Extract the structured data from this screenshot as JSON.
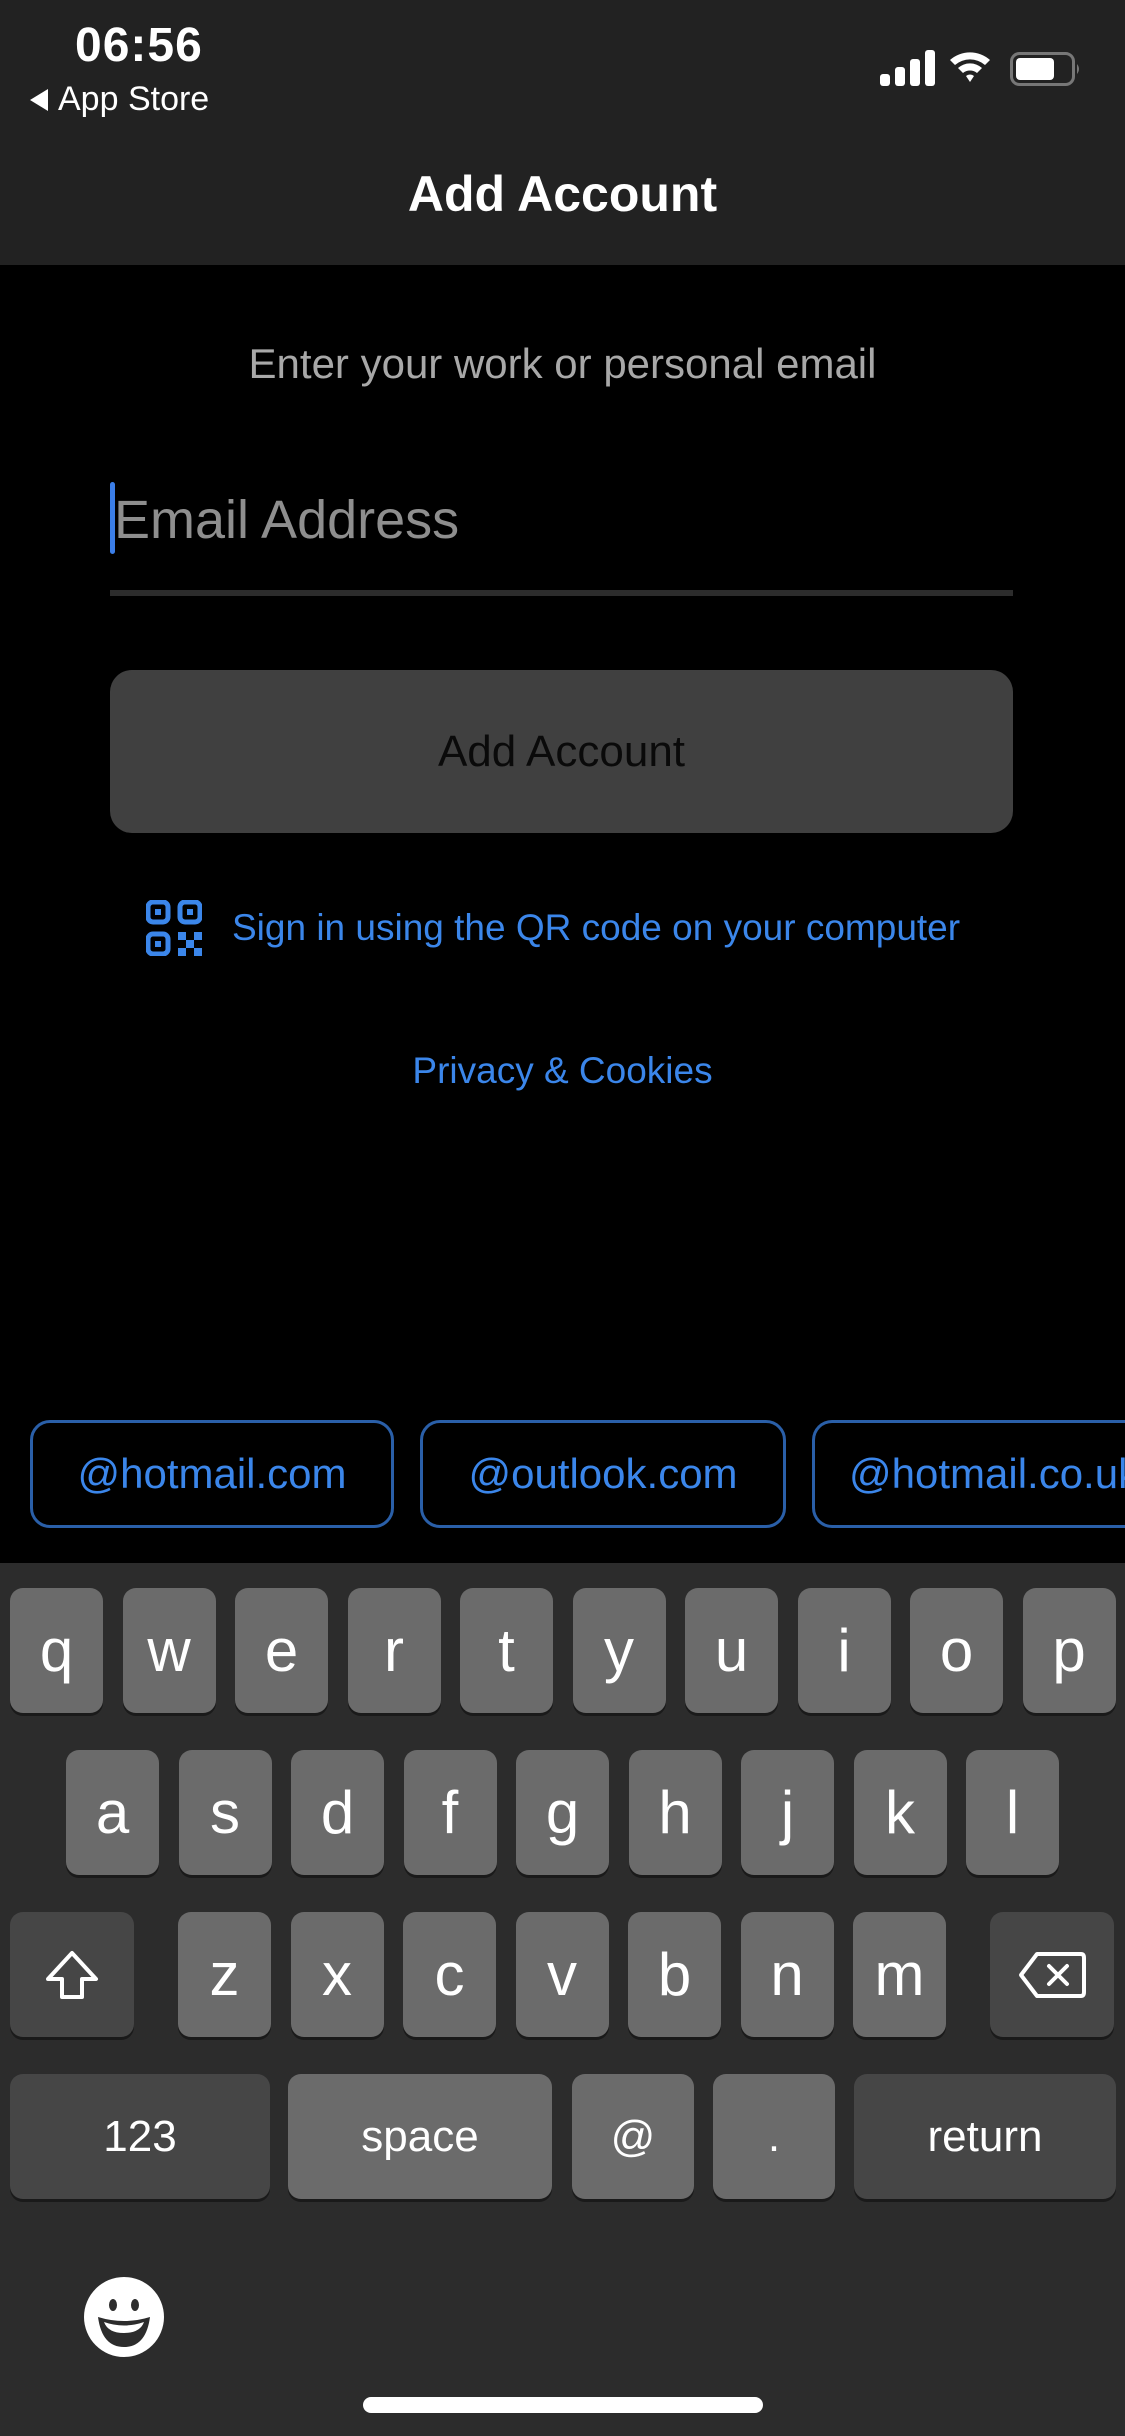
{
  "status_bar": {
    "time": "06:56",
    "back_app": "App Store",
    "battery_level": 0.7
  },
  "nav": {
    "title": "Add Account"
  },
  "form": {
    "subtitle": "Enter your work or personal email",
    "email_value": "",
    "email_placeholder": "Email Address",
    "add_button": "Add Account",
    "qr_link": "Sign in using the QR code on your computer",
    "privacy_link": "Privacy & Cookies"
  },
  "suggestions": [
    "@hotmail.com",
    "@outlook.com",
    "@hotmail.co.uk"
  ],
  "keyboard": {
    "row1": [
      "q",
      "w",
      "e",
      "r",
      "t",
      "y",
      "u",
      "i",
      "o",
      "p"
    ],
    "row2": [
      "a",
      "s",
      "d",
      "f",
      "g",
      "h",
      "j",
      "k",
      "l"
    ],
    "row3": [
      "z",
      "x",
      "c",
      "v",
      "b",
      "n",
      "m"
    ],
    "numbers": "123",
    "space": "space",
    "at": "@",
    "dot": ".",
    "return": "return"
  },
  "colors": {
    "accent": "#3b86ea",
    "nav_bg": "#222222",
    "button_bg": "#404040",
    "key_bg": "#6b6b6b",
    "key_dark_bg": "#464646",
    "keyboard_bg": "#2c2c2c"
  }
}
